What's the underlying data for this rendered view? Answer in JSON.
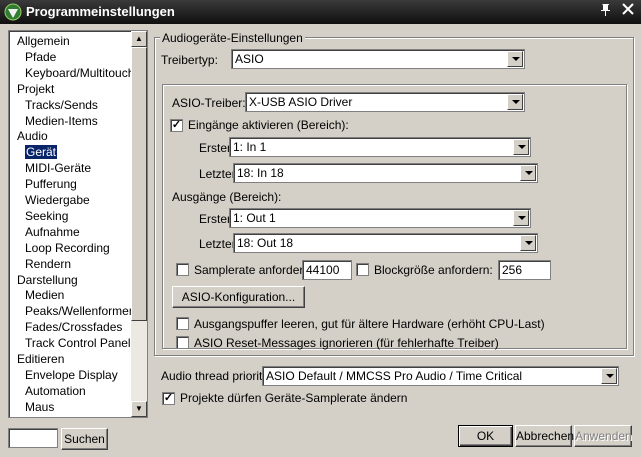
{
  "window": {
    "title": "Programmeinstellungen"
  },
  "tree": {
    "items": [
      {
        "label": "Allgemein",
        "level": 0
      },
      {
        "label": "Pfade",
        "level": 1
      },
      {
        "label": "Keyboard/Multitouch",
        "level": 1
      },
      {
        "label": "Projekt",
        "level": 0
      },
      {
        "label": "Tracks/Sends",
        "level": 1
      },
      {
        "label": "Medien-Items",
        "level": 1
      },
      {
        "label": "Audio",
        "level": 0
      },
      {
        "label": "Gerät",
        "level": 1,
        "selected": true
      },
      {
        "label": "MIDI-Geräte",
        "level": 1
      },
      {
        "label": "Pufferung",
        "level": 1
      },
      {
        "label": "Wiedergabe",
        "level": 1
      },
      {
        "label": "Seeking",
        "level": 1
      },
      {
        "label": "Aufnahme",
        "level": 1
      },
      {
        "label": "Loop Recording",
        "level": 1
      },
      {
        "label": "Rendern",
        "level": 1
      },
      {
        "label": "Darstellung",
        "level": 0
      },
      {
        "label": "Medien",
        "level": 1
      },
      {
        "label": "Peaks/Wellenformen",
        "level": 1
      },
      {
        "label": "Fades/Crossfades",
        "level": 1
      },
      {
        "label": "Track Control Panels",
        "level": 1
      },
      {
        "label": "Editieren",
        "level": 0
      },
      {
        "label": "Envelope Display",
        "level": 1
      },
      {
        "label": "Automation",
        "level": 1
      },
      {
        "label": "Maus",
        "level": 1
      }
    ]
  },
  "search": {
    "value": "",
    "button_label": "Suchen"
  },
  "audio": {
    "group_title": "Audiogeräte-Einstellungen",
    "driver_type_label": "Treibertyp:",
    "driver_type_value": "ASIO",
    "asio_driver_label": "ASIO-Treiber:",
    "asio_driver_value": "X-USB ASIO Driver",
    "enable_inputs_label": "Eingänge aktivieren (Bereich):",
    "enable_inputs_checked": true,
    "inputs_first_label": "Erster",
    "inputs_first_value": "1: In 1",
    "inputs_last_label": "Letzter",
    "inputs_last_value": "18: In 18",
    "outputs_label": "Ausgänge (Bereich):",
    "outputs_first_label": "Erster",
    "outputs_first_value": "1: Out 1",
    "outputs_last_label": "Letzter",
    "outputs_last_value": "18: Out 18",
    "samplerate_label": "Samplerate anfordern:",
    "samplerate_checked": false,
    "samplerate_value": "44100",
    "blocksize_label": "Blockgröße anfordern:",
    "blocksize_checked": false,
    "blocksize_value": "256",
    "asio_config_button": "ASIO-Konfiguration...",
    "flush_outputs_label": "Ausgangspuffer leeren, gut für ältere Hardware (erhöht CPU-Last)",
    "flush_outputs_checked": false,
    "ignore_reset_label": "ASIO Reset-Messages ignorieren (für fehlerhafte Treiber)",
    "ignore_reset_checked": false,
    "thread_priority_label": "Audio thread priority:",
    "thread_priority_value": "ASIO Default / MMCSS Pro Audio / Time Critical",
    "allow_samplerate_label": "Projekte dürfen Geräte-Samplerate ändern",
    "allow_samplerate_checked": true
  },
  "footer": {
    "ok": "OK",
    "cancel": "Abbrechen",
    "apply": "Anwenden"
  },
  "colors": {
    "selection": "#0a246a",
    "face": "#d4d0c8"
  }
}
